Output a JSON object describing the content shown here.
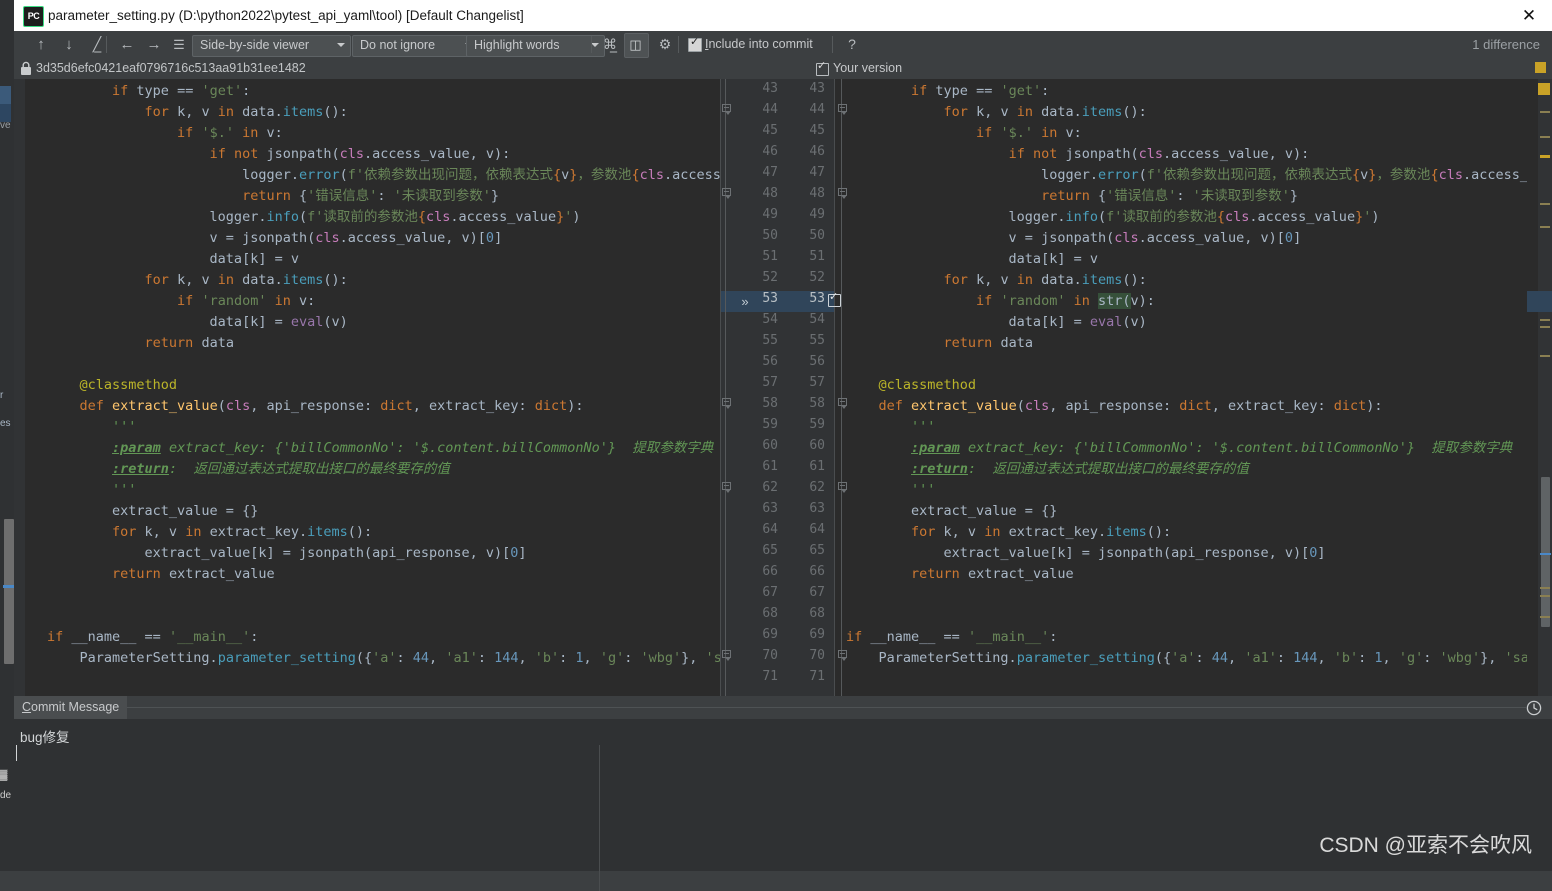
{
  "window": {
    "app_icon_label": "PC",
    "title": "parameter_setting.py (D:\\python2022\\pytest_api_yaml\\tool) [Default Changelist]",
    "close_icon": "close-icon"
  },
  "toolbar": {
    "icons": [
      {
        "name": "previous-difference-icon",
        "glyph": "↑"
      },
      {
        "name": "next-difference-icon",
        "glyph": "↓"
      },
      {
        "name": "edit-icon",
        "glyph": "╱"
      },
      {
        "name": "navigate-back-icon",
        "glyph": "←"
      },
      {
        "name": "navigate-forward-icon",
        "glyph": "→"
      },
      {
        "name": "list-lines-icon",
        "glyph": "☰"
      },
      {
        "name": "collapse-unchanged-icon",
        "glyph": "⬍"
      },
      {
        "name": "settings-gear-icon",
        "glyph": "⚙"
      }
    ],
    "viewer_mode": "Side-by-side viewer",
    "ignore_policy": "Do not ignore",
    "highlight_mode": "Highlight words",
    "columns_icon": "columns-diff-icon",
    "include_into_commit": "Include into commit",
    "include_checked": true,
    "help_label": "?",
    "difference_count": "1 difference"
  },
  "revision_row": {
    "lock_icon": "lock-icon",
    "hash": "3d35d6efc0421eaf0796716c513aa91b31ee1482",
    "your_version_label": "Your version",
    "your_version_checked": true
  },
  "diff": {
    "left_line_numbers": [
      43,
      44,
      45,
      46,
      47,
      48,
      49,
      50,
      51,
      52,
      53,
      54,
      55,
      56,
      57,
      58,
      59,
      60,
      61,
      62,
      63,
      64,
      65,
      66,
      67,
      68,
      69,
      70,
      71
    ],
    "right_line_numbers": [
      43,
      44,
      45,
      46,
      47,
      48,
      49,
      50,
      51,
      52,
      53,
      54,
      55,
      56,
      57,
      58,
      59,
      60,
      61,
      62,
      63,
      64,
      65,
      66,
      67,
      68,
      69,
      70,
      71
    ],
    "changed_line": 53,
    "changed_marker_icon": "chevron-double-right-icon",
    "left_changed_text": "if 'random' in v:",
    "right_changed_text": "if 'random' in str(v):",
    "inserted_token": "str(",
    "status_check_icon": "checkmark-icon",
    "left_code_lines": [
      "        if type == 'get':",
      "            for k, v in data.items():",
      "                if '$.' in v:",
      "                    if not jsonpath(cls.access_value, v):",
      "                        logger.error(f'依赖参数出现问题，依赖表达式{v}，参数池{cls.access_",
      "                        return {'错误信息': '未读取到参数'}",
      "                    logger.info(f'读取前的参数池{cls.access_value}')",
      "                    v = jsonpath(cls.access_value, v)[0]",
      "                    data[k] = v",
      "            for k, v in data.items():",
      "                if 'random' in v:",
      "                    data[k] = eval(v)",
      "            return data",
      "",
      "    @classmethod",
      "    def extract_value(cls, api_response: dict, extract_key: dict):",
      "        '''",
      "        :param extract_key: {'billCommonNo': '$.content.billCommonNo'} 提取参数字典",
      "        :return: 返回通过表达式提取出接口的最终要存的值",
      "        '''",
      "        extract_value = {}",
      "        for k, v in extract_key.items():",
      "            extract_value[k] = jsonpath(api_response, v)[0]",
      "        return extract_value",
      "",
      "",
      "if __name__ == '__main__':",
      "    ParameterSetting.parameter_setting({'a': 44, 'a1': 144, 'b': 1, 'g': 'wbg'}, 'save"
    ],
    "right_code_lines": [
      "        if type == 'get':",
      "            for k, v in data.items():",
      "                if '$.' in v:",
      "                    if not jsonpath(cls.access_value, v):",
      "                        logger.error(f'依赖参数出现问题，依赖表达式{v}，参数池{cls.access_val",
      "                        return {'错误信息': '未读取到参数'}",
      "                    logger.info(f'读取前的参数池{cls.access_value}')",
      "                    v = jsonpath(cls.access_value, v)[0]",
      "                    data[k] = v",
      "            for k, v in data.items():",
      "                if 'random' in str(v):",
      "                    data[k] = eval(v)",
      "            return data",
      "",
      "    @classmethod",
      "    def extract_value(cls, api_response: dict, extract_key: dict):",
      "        '''",
      "        :param extract_key: {'billCommonNo': '$.content.billCommonNo'} 提取参数字典",
      "        :return: 返回通过表达式提取出接口的最终要存的值",
      "        '''",
      "        extract_value = {}",
      "        for k, v in extract_key.items():",
      "            extract_value[k] = jsonpath(api_response, v)[0]",
      "        return extract_value",
      "",
      "",
      "if __name__ == '__main__':",
      "    ParameterSetting.parameter_setting({'a': 44, 'a1': 144, 'b': 1, 'g': 'wbg'}, 'save')"
    ]
  },
  "commit": {
    "tab_label": "Commit Message",
    "message": "bug修复",
    "history_icon": "clock-history-icon"
  },
  "watermark": "CSDN @亚索不会吹风",
  "colors": {
    "editor_bg": "#2b2b2b",
    "chrome_bg": "#3c3f41",
    "gutter_bg": "#313335",
    "diff_highlight": "#30455a",
    "inserted_highlight": "#36503a",
    "titlebar_bg": "#ffffff",
    "accent_yellow": "#c9a227",
    "accent_blue": "#4a88c7",
    "check_green": "#4a9c4a"
  },
  "peek": {
    "t1": "ve",
    "t2": "r",
    "t3": "es",
    "t4": "▓",
    "t5": "de"
  }
}
